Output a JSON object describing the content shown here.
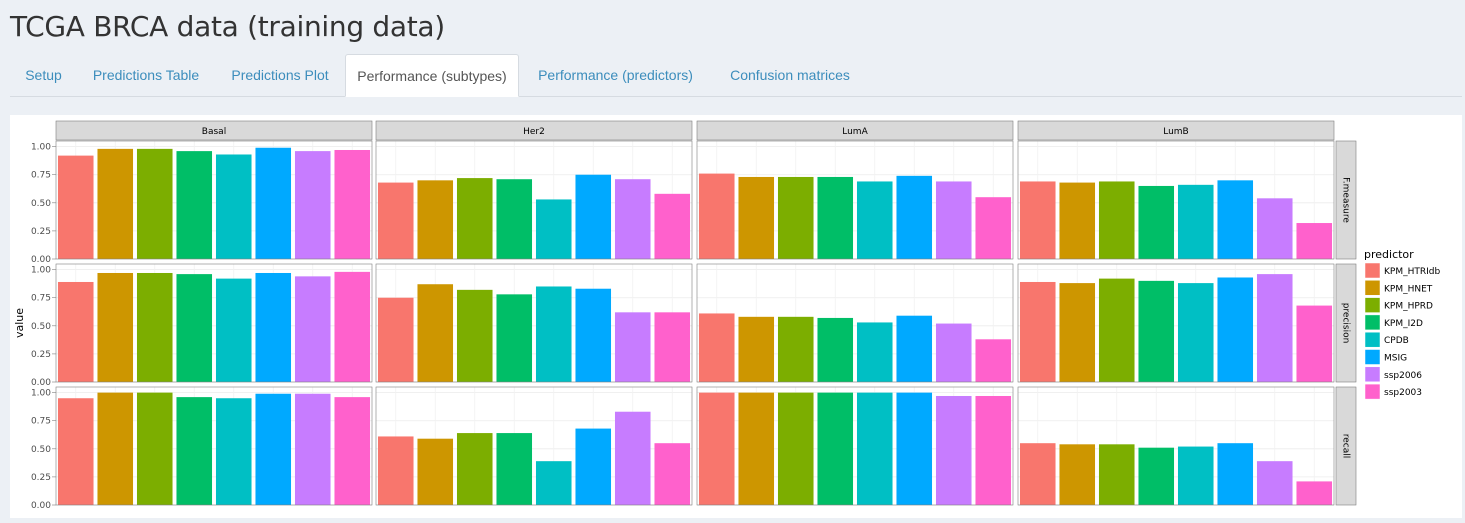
{
  "app": {
    "title": "TCGA BRCA data (training data)"
  },
  "tabs": [
    {
      "label": "Setup",
      "active": false
    },
    {
      "label": "Predictions Table",
      "active": false
    },
    {
      "label": "Predictions Plot",
      "active": false
    },
    {
      "label": "Performance (subtypes)",
      "active": true
    },
    {
      "label": "Performance (predictors)",
      "active": false
    },
    {
      "label": "Confusion matrices",
      "active": false
    }
  ],
  "chart_data": {
    "type": "bar",
    "ylabel": "value",
    "ylim": [
      0,
      1.05
    ],
    "yticks": [
      "0.00",
      "0.25",
      "0.50",
      "0.75",
      "1.00"
    ],
    "grid": true,
    "legend_position": "right",
    "legend_title": "predictor",
    "predictors": [
      "KPM_HTRIdb",
      "KPM_HNET",
      "KPM_HPRD",
      "KPM_I2D",
      "CPDB",
      "MSIG",
      "ssp2006",
      "ssp2003"
    ],
    "colors": [
      "#F8766D",
      "#CD9600",
      "#7CAE00",
      "#00BE67",
      "#00BFC4",
      "#00A9FF",
      "#C77CFF",
      "#FF61CC"
    ],
    "columns": [
      "Basal",
      "Her2",
      "LumA",
      "LumB"
    ],
    "rows": [
      "F.measure",
      "precision",
      "recall"
    ],
    "values": {
      "F.measure": {
        "Basal": [
          0.92,
          0.98,
          0.98,
          0.96,
          0.93,
          0.99,
          0.96,
          0.97
        ],
        "Her2": [
          0.68,
          0.7,
          0.72,
          0.71,
          0.53,
          0.75,
          0.71,
          0.58
        ],
        "LumA": [
          0.76,
          0.73,
          0.73,
          0.73,
          0.69,
          0.74,
          0.69,
          0.55
        ],
        "LumB": [
          0.69,
          0.68,
          0.69,
          0.65,
          0.66,
          0.7,
          0.54,
          0.32
        ]
      },
      "precision": {
        "Basal": [
          0.89,
          0.97,
          0.97,
          0.96,
          0.92,
          0.97,
          0.94,
          0.98
        ],
        "Her2": [
          0.75,
          0.87,
          0.82,
          0.78,
          0.85,
          0.83,
          0.62,
          0.62
        ],
        "LumA": [
          0.61,
          0.58,
          0.58,
          0.57,
          0.53,
          0.59,
          0.52,
          0.38
        ],
        "LumB": [
          0.89,
          0.88,
          0.92,
          0.9,
          0.88,
          0.93,
          0.96,
          0.68
        ]
      },
      "recall": {
        "Basal": [
          0.95,
          1.0,
          1.0,
          0.96,
          0.95,
          0.99,
          0.99,
          0.96
        ],
        "Her2": [
          0.61,
          0.59,
          0.64,
          0.64,
          0.39,
          0.68,
          0.83,
          0.55
        ],
        "LumA": [
          1.0,
          1.0,
          1.0,
          1.0,
          1.0,
          1.0,
          0.97,
          0.97
        ],
        "LumB": [
          0.55,
          0.54,
          0.54,
          0.51,
          0.52,
          0.55,
          0.39,
          0.21
        ]
      }
    }
  }
}
